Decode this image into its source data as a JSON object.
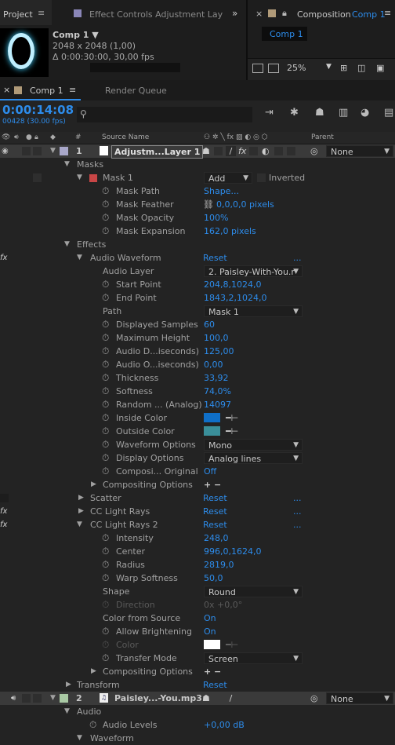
{
  "project_panel": {
    "tab": "Project",
    "comp_name": "Comp 1 ▼",
    "size": "2048 x 2048 (1,00)",
    "duration": "Δ 0:00:30:00, 30,00 fps"
  },
  "effect_controls": {
    "tab": "Effect Controls Adjustment Lay"
  },
  "composition_panel": {
    "tab": "Composition",
    "tab_comp": "Comp 1",
    "sub_tab": "Comp 1",
    "zoom": "25%"
  },
  "timeline": {
    "tab": "Comp 1",
    "render_queue": "Render Queue",
    "timecode": "0:00:14:08",
    "frame": "00428 (30.00 fps)"
  },
  "headers": {
    "num": "#",
    "source": "Source Name",
    "parent": "Parent"
  },
  "layer1": {
    "num": "1",
    "name": "Adjustm...Layer 1",
    "parent": "None"
  },
  "masks": {
    "group": "Masks",
    "mask": "Mask 1",
    "mode": "Add",
    "inverted": "Inverted",
    "path_lbl": "Mask Path",
    "path_val": "Shape...",
    "feather_lbl": "Mask Feather",
    "feather_val": "0,0,0,0 pixels",
    "opacity_lbl": "Mask Opacity",
    "opacity_val": "100%",
    "expansion_lbl": "Mask Expansion",
    "expansion_val": "162,0 pixels"
  },
  "effects": {
    "group": "Effects",
    "reset": "Reset",
    "dots": "..."
  },
  "audio_waveform": {
    "name": "Audio Waveform",
    "audio_layer_lbl": "Audio Layer",
    "audio_layer_val": "2. Paisley-With-You.r",
    "start_lbl": "Start Point",
    "start_val": "204,8,1024,0",
    "end_lbl": "End Point",
    "end_val": "1843,2,1024,0",
    "path_lbl": "Path",
    "path_val": "Mask 1",
    "samples_lbl": "Displayed Samples",
    "samples_val": "60",
    "maxh_lbl": "Maximum Height",
    "maxh_val": "100,0",
    "adur_lbl": "Audio D...iseconds)",
    "adur_val": "125,00",
    "aoff_lbl": "Audio O...iseconds)",
    "aoff_val": "0,00",
    "thick_lbl": "Thickness",
    "thick_val": "33,92",
    "soft_lbl": "Softness",
    "soft_val": "74,0%",
    "rand_lbl": "Random ... (Analog)",
    "rand_val": "14097",
    "inside_lbl": "Inside Color",
    "inside_color": "#0f6fc8",
    "outside_lbl": "Outside Color",
    "outside_color": "#3a8f9a",
    "wopt_lbl": "Waveform Options",
    "wopt_val": "Mono",
    "dopt_lbl": "Display Options",
    "dopt_val": "Analog lines",
    "comp_lbl": "Composi... Original",
    "comp_val": "Off",
    "compopt_lbl": "Compositing Options",
    "plusminus": "+ −"
  },
  "scatter": {
    "name": "Scatter"
  },
  "light1": {
    "name": "CC Light Rays"
  },
  "light2": {
    "name": "CC Light Rays 2",
    "int_lbl": "Intensity",
    "int_val": "248,0",
    "center_lbl": "Center",
    "center_val": "996,0,1624,0",
    "radius_lbl": "Radius",
    "radius_val": "2819,0",
    "warp_lbl": "Warp Softness",
    "warp_val": "50,0",
    "shape_lbl": "Shape",
    "shape_val": "Round",
    "dir_lbl": "Direction",
    "dir_val": "0x +0,0°",
    "cfs_lbl": "Color from Source",
    "cfs_val": "On",
    "ab_lbl": "Allow Brightening",
    "ab_val": "On",
    "color_lbl": "Color",
    "tm_lbl": "Transfer Mode",
    "tm_val": "Screen",
    "compopt_lbl": "Compositing Options"
  },
  "transform": {
    "name": "Transform",
    "reset": "Reset"
  },
  "layer2": {
    "num": "2",
    "name": "Paisley...-You.mp3",
    "parent": "None",
    "audio": "Audio",
    "levels_lbl": "Audio Levels",
    "levels_val": "+0,00 dB",
    "waveform": "Waveform"
  }
}
